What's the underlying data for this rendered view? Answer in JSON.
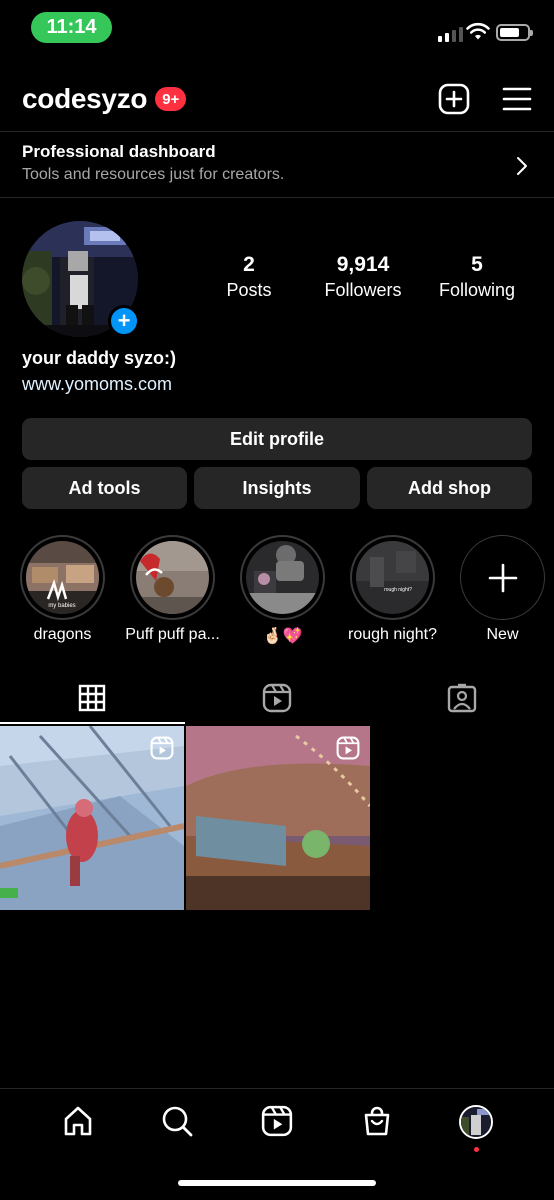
{
  "status_bar": {
    "time": "11:14"
  },
  "header": {
    "username": "codesyzo",
    "notification_badge": "9+"
  },
  "dashboard": {
    "title": "Professional dashboard",
    "subtitle": "Tools and resources just for creators."
  },
  "profile": {
    "stats": [
      {
        "value": "2",
        "label": "Posts"
      },
      {
        "value": "9,914",
        "label": "Followers"
      },
      {
        "value": "5",
        "label": "Following"
      }
    ],
    "name": "your daddy syzo:)",
    "link": "www.yomoms.com"
  },
  "buttons": {
    "edit_profile": "Edit profile",
    "ad_tools": "Ad tools",
    "insights": "Insights",
    "add_shop": "Add shop"
  },
  "highlights": [
    {
      "label": "dragons",
      "overlay_text": "my babies"
    },
    {
      "label": "Puff puff pa..."
    },
    {
      "label": "🤞🏻💖"
    },
    {
      "label": "rough night?",
      "overlay_text": "rough night?"
    },
    {
      "label": "New"
    }
  ],
  "tabs": [
    {
      "name": "grid-icon",
      "active": true
    },
    {
      "name": "reels-icon",
      "active": false
    },
    {
      "name": "tagged-icon",
      "active": false
    }
  ],
  "posts": [
    {
      "type": "reel"
    },
    {
      "type": "reel"
    }
  ],
  "bottom_nav": [
    "home-icon",
    "search-icon",
    "reels-icon",
    "shop-icon",
    "profile-avatar"
  ],
  "colors": {
    "accent_blue": "#0095f6",
    "badge_red": "#ff3040",
    "time_pill_green": "#35c759",
    "button_gray": "#262626"
  }
}
